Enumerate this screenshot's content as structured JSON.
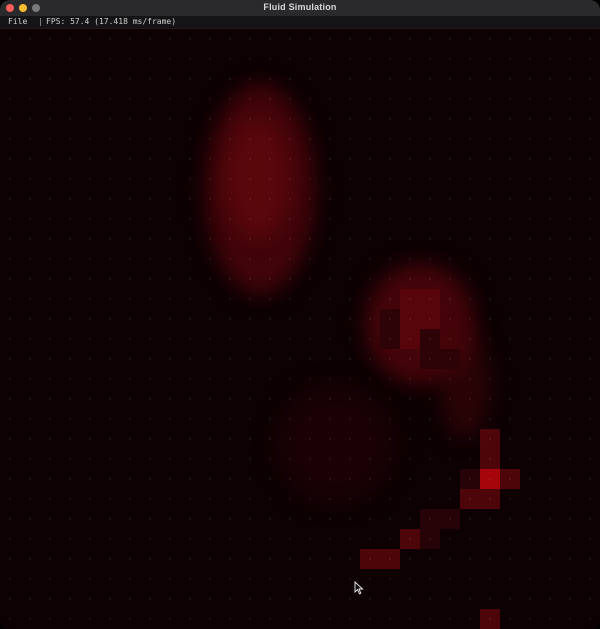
{
  "window": {
    "title": "Fluid Simulation"
  },
  "menu": {
    "file_label": "File",
    "separator": "|",
    "fps_text": "FPS: 57.4 (17.418 ms/frame)"
  },
  "colors": {
    "background": "#0d0103",
    "fluid_dark": "#2a0307",
    "fluid_mid": "#5a060c",
    "fluid_bright": "#b0050d"
  },
  "icons": {
    "close": "close-icon",
    "minimize": "minimize-icon",
    "maximize": "maximize-icon",
    "cursor": "mouse-pointer-icon"
  }
}
